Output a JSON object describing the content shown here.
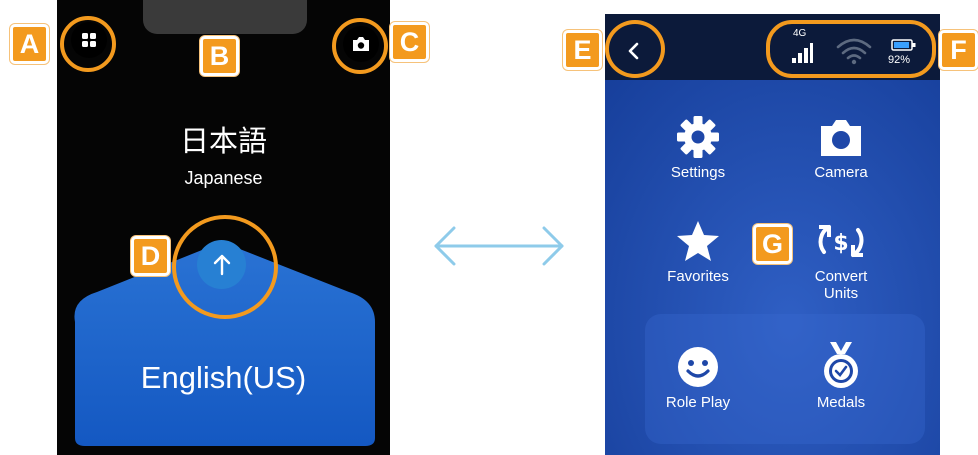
{
  "left_screen": {
    "source_language": "日本語",
    "source_language_en": "Japanese",
    "target_language": "English(US)",
    "icons": {
      "menu": "grid-icon",
      "camera": "camera-icon",
      "swap": "up-arrow-icon"
    }
  },
  "right_screen": {
    "status": {
      "network": "4G",
      "battery": "92%"
    },
    "menu": [
      {
        "label": "Settings",
        "icon": "gear-icon"
      },
      {
        "label": "Camera",
        "icon": "camera-icon"
      },
      {
        "label": "Favorites",
        "icon": "star-icon"
      },
      {
        "label": "Convert\nUnits",
        "icon": "currency-convert-icon"
      },
      {
        "label": "Role Play",
        "icon": "smiley-icon"
      },
      {
        "label": "Medals",
        "icon": "medal-icon"
      }
    ]
  },
  "callouts": [
    "A",
    "B",
    "C",
    "D",
    "E",
    "F",
    "G"
  ],
  "colors": {
    "callout": "#f39a1e",
    "panel_blue": "#1e64c8",
    "right_bg": "#1e47a8",
    "swap_button": "#2780d3"
  }
}
